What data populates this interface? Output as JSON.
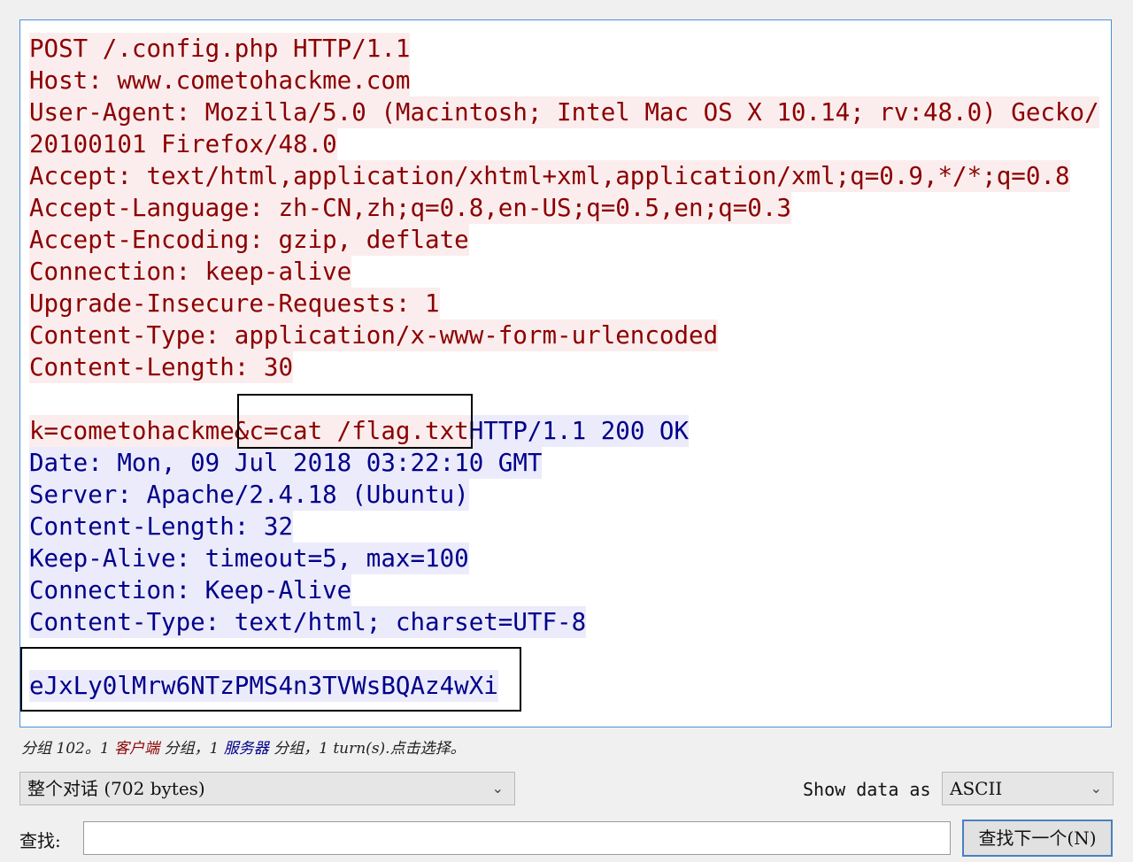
{
  "stream": {
    "request_lines": [
      "POST /.config.php HTTP/1.1",
      "Host: www.cometohackme.com",
      "User-Agent: Mozilla/5.0 (Macintosh; Intel Mac OS X 10.14; rv:48.0) Gecko/",
      "20100101 Firefox/48.0",
      "Accept: text/html,application/xhtml+xml,application/xml;q=0.9,*/*;q=0.8",
      "Accept-Language: zh-CN,zh;q=0.8,en-US;q=0.5,en;q=0.3",
      "Accept-Encoding: gzip, deflate",
      "Connection: keep-alive",
      "Upgrade-Insecure-Requests: 1",
      "Content-Type: application/x-www-form-urlencoded",
      "Content-Length: 30"
    ],
    "request_body": "k=cometohackme&c=cat /flag.txt",
    "response_lines": [
      "HTTP/1.1 200 OK",
      "Date: Mon, 09 Jul 2018 03:22:10 GMT",
      "Server: Apache/2.4.18 (Ubuntu)",
      "Content-Length: 32",
      "Keep-Alive: timeout=5, max=100",
      "Connection: Keep-Alive",
      "Content-Type: text/html; charset=UTF-8"
    ],
    "response_body": "eJxLy0lMrw6NTzPMS4n3TVWsBQAz4wXi"
  },
  "summary": {
    "part1": "分组 102。1 ",
    "client": "客户端",
    "part2": " 分组，1 ",
    "server": "服务器",
    "part3": " 分组，1 turn(s).点击选择。"
  },
  "conversation_select": {
    "value": "整个对话 (702 bytes)"
  },
  "show_data": {
    "label": "Show data as",
    "value": "ASCII"
  },
  "find": {
    "label": "查找:",
    "value": "",
    "button": "查找下一个(N)"
  },
  "colors": {
    "client_text": "#8b0000",
    "client_bg": "#fbeded",
    "server_text": "#00008b",
    "server_bg": "#ebebfb"
  },
  "icons": {
    "dropdown": "chevron-down-icon"
  }
}
